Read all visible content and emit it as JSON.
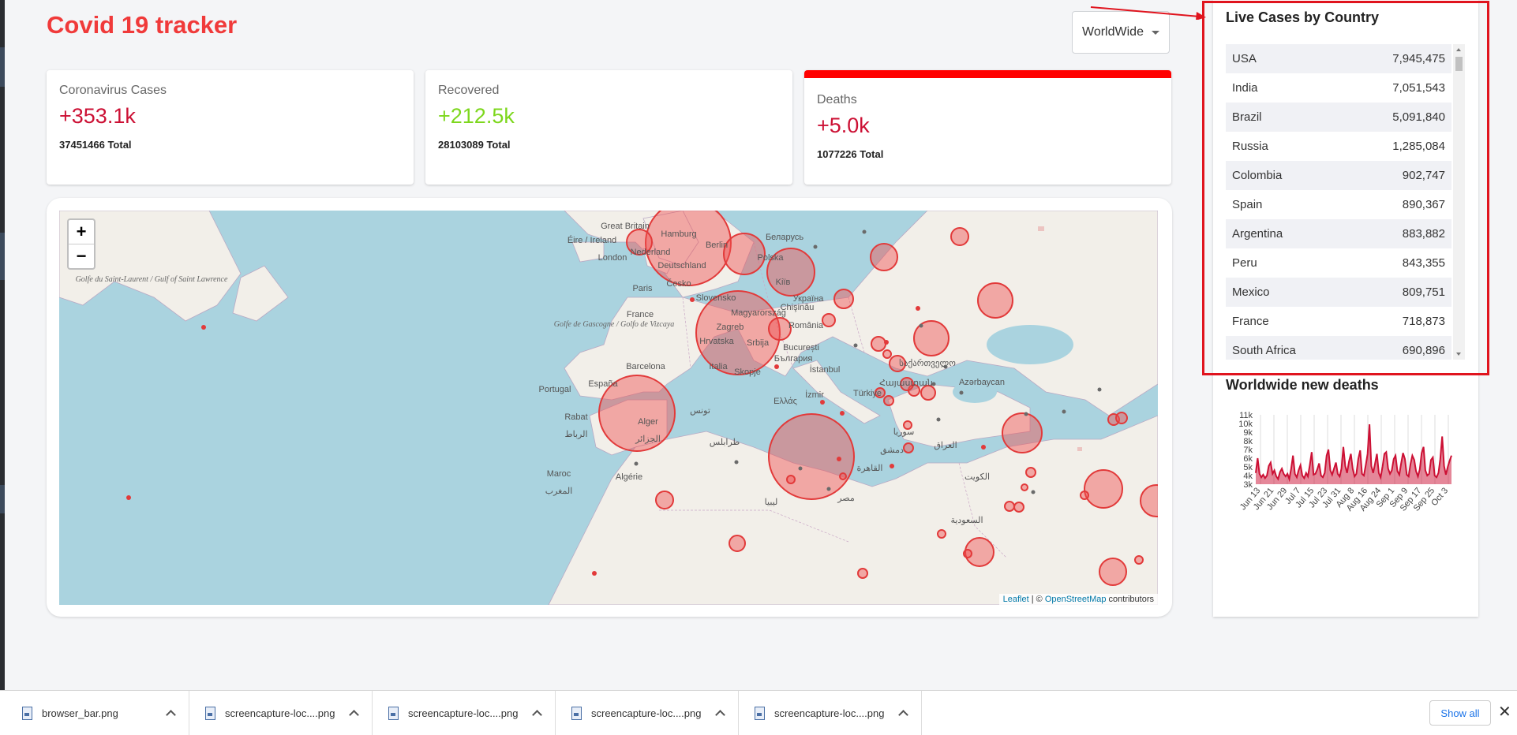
{
  "header": {
    "title": "Covid 19 tracker",
    "dropdown_value": "WorldWide"
  },
  "cards": [
    {
      "title": "Coronavirus Cases",
      "value": "+353.1k",
      "total": "37451466 Total",
      "color": "#cc1034"
    },
    {
      "title": "Recovered",
      "value": "+212.5k",
      "total": "28103089 Total",
      "color": "#7dd71d"
    },
    {
      "title": "Deaths",
      "value": "+5.0k",
      "total": "1077226 Total",
      "color": "#cc1034"
    }
  ],
  "map": {
    "zoom_in": "+",
    "zoom_out": "−",
    "attribution": {
      "leaflet": "Leaflet",
      "sep": " | © ",
      "osm": "OpenStreetMap",
      "suffix": " contributors"
    },
    "labels": [
      "Great Britain",
      "Éire / Ireland",
      "London",
      "Nederland",
      "Hamburg",
      "Berlin",
      "Беларусь",
      "Deutschland",
      "Polska",
      "Kiïв",
      "Україна",
      "Česko",
      "Slovensko",
      "Paris",
      "France",
      "Magyarország",
      "Chişinău",
      "Zagreb",
      "România",
      "Hrvatska",
      "Srbija",
      "București",
      "Italia",
      "България",
      "Barcelona",
      "Skopje",
      "İstanbul",
      "España",
      "Portugal",
      "Ελλάς",
      "İzmir",
      "Türkiye",
      "საქართველო",
      "Հայաստան",
      "Azərbaycan",
      "Rabat",
      "الرباط",
      "Alger",
      "الجزائر",
      "تونس",
      "طرابلس",
      "Maroc",
      "المغرب",
      "Algérie",
      "ليبيا",
      "مصر",
      "القاهرة",
      "دمشق",
      "سوريا",
      "العراق",
      "الكويت",
      "السعودية",
      "Golfe du Saint-Laurent / Gulf of Saint Lawrence",
      "Golfe de Gascogne / Golfo de Vizcaya"
    ]
  },
  "table": {
    "heading": "Live Cases by Country",
    "rows": [
      {
        "country": "USA",
        "cases": "7,945,475"
      },
      {
        "country": "India",
        "cases": "7,051,543"
      },
      {
        "country": "Brazil",
        "cases": "5,091,840"
      },
      {
        "country": "Russia",
        "cases": "1,285,084"
      },
      {
        "country": "Colombia",
        "cases": "902,747"
      },
      {
        "country": "Spain",
        "cases": "890,367"
      },
      {
        "country": "Argentina",
        "cases": "883,882"
      },
      {
        "country": "Peru",
        "cases": "843,355"
      },
      {
        "country": "Mexico",
        "cases": "809,751"
      },
      {
        "country": "France",
        "cases": "718,873"
      },
      {
        "country": "South Africa",
        "cases": "690,896"
      }
    ]
  },
  "chart_data": {
    "type": "area",
    "title": "Worldwide new deaths",
    "y_tick_labels": [
      "11k",
      "10k",
      "9k",
      "8k",
      "7k",
      "6k",
      "5k",
      "4k",
      "3k"
    ],
    "ylim": [
      3000,
      11000
    ],
    "x_tick_labels": [
      "Jun 13",
      "Jun 21",
      "Jun 29",
      "Jul 7",
      "Jul 15",
      "Jul 23",
      "Jul 31",
      "Aug 8",
      "Aug 16",
      "Aug 24",
      "Sep 1",
      "Sep 9",
      "Sep 17",
      "Sep 25",
      "Oct 3"
    ],
    "series": [
      {
        "values": [
          4300,
          6000,
          4200,
          3800,
          4100,
          3700,
          4000,
          5100,
          5500,
          4200,
          4600,
          3900,
          3600,
          4400,
          4800,
          4200,
          3900,
          4200,
          3600,
          4800,
          6300,
          4200,
          3800,
          4600,
          5200,
          4000,
          3700,
          4300,
          3900,
          5200,
          6700,
          4100,
          4200,
          4700,
          5400,
          4000,
          3800,
          4300,
          6300,
          7000,
          4600,
          4100,
          4800,
          5500,
          4200,
          3900,
          4800,
          7300,
          5100,
          4300,
          5600,
          6500,
          4800,
          3900,
          4200,
          5900,
          6900,
          4200,
          4000,
          5200,
          6500,
          9900,
          5100,
          4300,
          5400,
          6500,
          4300,
          3800,
          5000,
          6500,
          6700,
          4800,
          4200,
          4600,
          5900,
          6300,
          4500,
          4100,
          5400,
          6600,
          5900,
          4100,
          3900,
          5300,
          6300,
          5800,
          4500,
          3900,
          4700,
          6600,
          7300,
          4600,
          4000,
          4200,
          5800,
          6100,
          4000,
          3800,
          4300,
          5900,
          8500,
          5100,
          4100,
          5000,
          5700,
          6300
        ]
      }
    ],
    "colors": {
      "line": "#cc1034",
      "fill": "rgba(204,16,52,0.5)"
    }
  },
  "downloads": {
    "items": [
      "browser_bar.png",
      "screencapture-loc....png",
      "screencapture-loc....png",
      "screencapture-loc....png",
      "screencapture-loc....png"
    ],
    "show_all": "Show all",
    "close": "✕"
  }
}
